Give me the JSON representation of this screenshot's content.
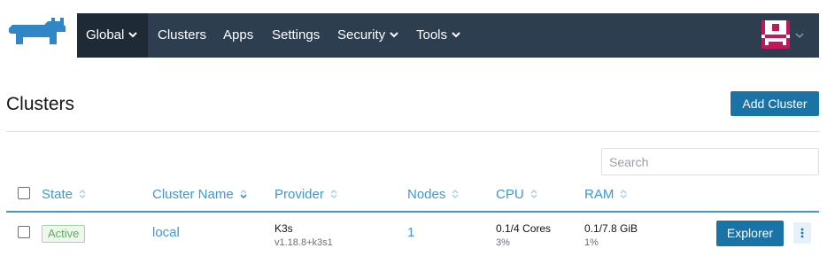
{
  "brand": {
    "logo_icon": "rancher-cow-logo-icon",
    "color": "#2f87c8"
  },
  "nav": {
    "items": [
      {
        "label": "Global",
        "has_caret": true,
        "active": true
      },
      {
        "label": "Clusters",
        "has_caret": false
      },
      {
        "label": "Apps",
        "has_caret": false
      },
      {
        "label": "Settings",
        "has_caret": false
      },
      {
        "label": "Security",
        "has_caret": true
      },
      {
        "label": "Tools",
        "has_caret": true
      }
    ],
    "background": "#2d3e50",
    "active_background": "#1e2a36",
    "avatar_icon": "user-avatar-icon"
  },
  "page": {
    "title": "Clusters",
    "add_button": "Add Cluster",
    "search_placeholder": "Search"
  },
  "table": {
    "columns": [
      "State",
      "Cluster Name",
      "Provider",
      "Nodes",
      "CPU",
      "RAM"
    ],
    "rows": [
      {
        "state": "Active",
        "name": "local",
        "provider": "K3s",
        "provider_version": "v1.18.8+k3s1",
        "nodes": "1",
        "cpu": "0.1/4 Cores",
        "cpu_pct": "3%",
        "ram": "0.1/7.8 GiB",
        "ram_pct": "1%",
        "action": "Explorer"
      }
    ]
  },
  "colors": {
    "primary_button": "#1a73a6",
    "link": "#3d98d3",
    "active_badge": "#5ab155"
  }
}
